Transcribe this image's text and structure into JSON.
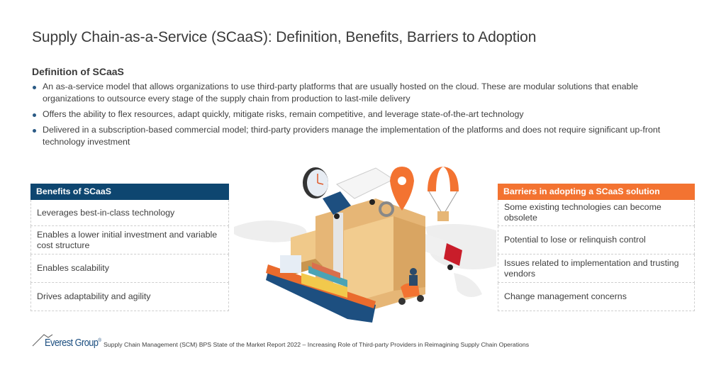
{
  "title": "Supply Chain-as-a-Service (SCaaS): Definition, Benefits, Barriers to Adoption",
  "definition": {
    "heading": "Definition of SCaaS",
    "bullets": [
      "An as-a-service model that allows organizations to use third-party platforms that are usually hosted on the cloud. These are modular solutions that enable organizations to outsource every stage of the supply chain from production to last-mile delivery",
      "Offers the ability to flex resources, adapt quickly, mitigate risks, remain competitive, and leverage state-of-the-art technology",
      "Delivered in a subscription-based commercial model; third-party providers manage the implementation of the platforms and does not require significant up-front technology investment"
    ]
  },
  "benefits": {
    "heading": "Benefits of SCaaS",
    "color": "#0e4670",
    "items": [
      "Leverages best-in-class technology",
      "Enables a lower initial investment and variable cost structure",
      "Enables scalability",
      "Drives adaptability and agility"
    ]
  },
  "barriers": {
    "heading": "Barriers in adopting a SCaaS solution",
    "color": "#f37331",
    "items": [
      "Some existing technologies can become obsolete",
      "Potential to lose or relinquish control",
      "Issues related to implementation and trusting vendors",
      "Change management concerns"
    ]
  },
  "illustration": {
    "icons": [
      "clock-icon",
      "truck-icon",
      "location-pin-icon",
      "gear-icon",
      "parachute-package-icon",
      "boxes-icon",
      "cargo-ship-icon",
      "delivery-scooter-icon",
      "red-truck-icon",
      "world-map-icon"
    ]
  },
  "footer": {
    "logo": "Everest Group",
    "logo_mark": "®",
    "source": "Supply Chain Management (SCM) BPS State of the Market Report 2022 – Increasing Role of Third-party Providers in Reimagining Supply Chain Operations"
  }
}
